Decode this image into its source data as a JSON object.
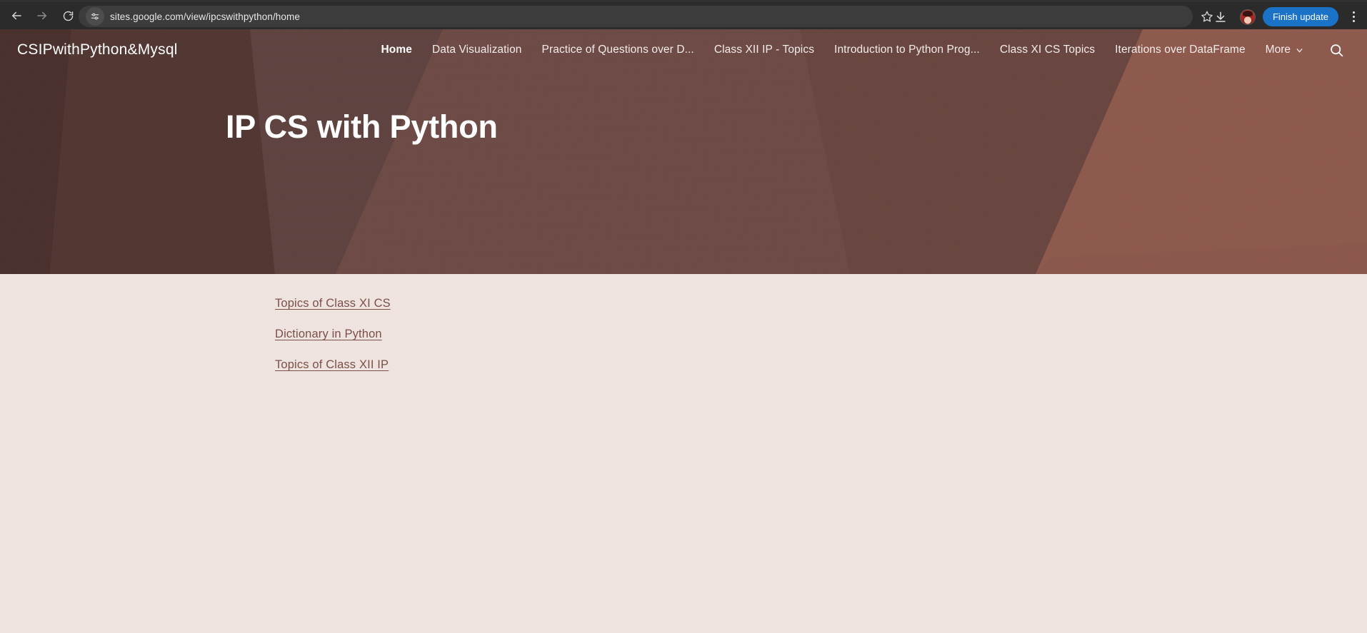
{
  "browser": {
    "back_label": "Back",
    "forward_label": "Forward",
    "reload_label": "Reload",
    "site_info_icon": "tune-sliders-icon",
    "url": "sites.google.com/view/ipcswithpython/home",
    "bookmark_icon": "star-icon",
    "downloads_icon": "download-icon",
    "avatar_label": "Profile",
    "update_button_label": "Finish update",
    "menu_icon": "three-dot-menu-icon",
    "toolbar_bg": "#2b2b2b",
    "omnibox_bg": "#3c3c3c",
    "update_button_color": "#1a73c7"
  },
  "site": {
    "title": "CSIPwithPython&Mysql",
    "banner_color": "#6b4a45",
    "page_background": "#efe3df",
    "nav": [
      {
        "label": "Home",
        "active": true
      },
      {
        "label": "Data Visualization",
        "active": false
      },
      {
        "label": "Practice of Questions over D...",
        "active": false
      },
      {
        "label": "Class XII IP - Topics",
        "active": false
      },
      {
        "label": "Introduction to Python Prog...",
        "active": false
      },
      {
        "label": "Class XI CS Topics",
        "active": false
      },
      {
        "label": "Iterations over DataFrame",
        "active": false
      }
    ],
    "more_label": "More",
    "more_icon": "chevron-down-icon",
    "search_icon": "search-icon",
    "hero_title": "IP CS with Python",
    "links": [
      {
        "label": "Topics of Class XI CS"
      },
      {
        "label": "Dictionary in Python"
      },
      {
        "label": "Topics of Class XII IP"
      }
    ],
    "link_color": "#7a5048"
  }
}
